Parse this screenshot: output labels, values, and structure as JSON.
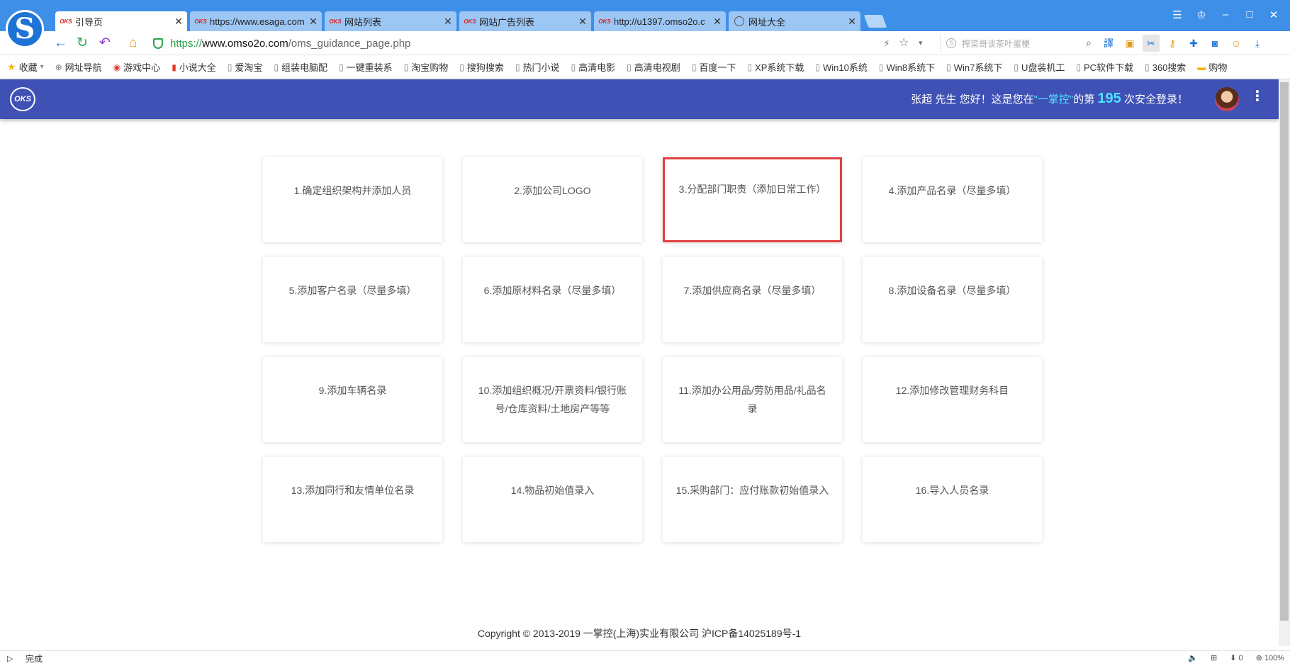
{
  "browser": {
    "tabs": [
      {
        "title": "引导页",
        "favicon": "OKS",
        "active": true
      },
      {
        "title": "https://www.esaga.com",
        "favicon": "OKS",
        "active": false
      },
      {
        "title": "网站列表",
        "favicon": "OKS",
        "active": false
      },
      {
        "title": "网站广告列表",
        "favicon": "OKS",
        "active": false
      },
      {
        "title": "http://u1397.omso2o.c",
        "favicon": "OKS",
        "active": false
      },
      {
        "title": "网址大全",
        "favicon": "globe-icon",
        "active": false
      }
    ],
    "close_glyph": "✕",
    "address": {
      "protocol": "https://",
      "host": "www.omso2o.com",
      "path": "/oms_guidance_page.php"
    },
    "search_placeholder": "搾菜哥谈茶叶蛋梗",
    "bookmarks": [
      {
        "label": "收藏",
        "icon": "star-icon"
      },
      {
        "label": "网址导航",
        "icon": "globe-icon"
      },
      {
        "label": "游戏中心",
        "icon": "game-icon"
      },
      {
        "label": "小说大全",
        "icon": "book-icon"
      },
      {
        "label": "爱淘宝",
        "icon": "page-icon"
      },
      {
        "label": "组装电脑配",
        "icon": "page-icon"
      },
      {
        "label": "一键重装系",
        "icon": "page-icon"
      },
      {
        "label": "淘宝购物",
        "icon": "page-icon"
      },
      {
        "label": "搜狗搜索",
        "icon": "page-icon"
      },
      {
        "label": "热门小说",
        "icon": "page-icon"
      },
      {
        "label": "高清电影",
        "icon": "page-icon"
      },
      {
        "label": "高清电视剧",
        "icon": "page-icon"
      },
      {
        "label": "百度一下",
        "icon": "page-icon"
      },
      {
        "label": "XP系统下载",
        "icon": "page-icon"
      },
      {
        "label": "Win10系统",
        "icon": "page-icon"
      },
      {
        "label": "Win8系统下",
        "icon": "page-icon"
      },
      {
        "label": "Win7系统下",
        "icon": "page-icon"
      },
      {
        "label": "U盘装机工",
        "icon": "page-icon"
      },
      {
        "label": "PC软件下载",
        "icon": "page-icon"
      },
      {
        "label": "360搜索",
        "icon": "page-icon"
      },
      {
        "label": "购物",
        "icon": "folder-icon"
      }
    ]
  },
  "header": {
    "logo_text": "OKS",
    "greeting_prefix": "张超 先生 您好！这是您在",
    "brand": "\"一掌控\"",
    "greeting_mid": "的第",
    "login_count": "195",
    "greeting_suffix": "次安全登录！"
  },
  "cards": [
    {
      "label": "1.确定组织架构并添加人员"
    },
    {
      "label": "2.添加公司LOGO"
    },
    {
      "label": "3.分配部门职责（添加日常工作）",
      "selected": true
    },
    {
      "label": "4.添加产品名录（尽量多填）"
    },
    {
      "label": "5.添加客户名录（尽量多填）"
    },
    {
      "label": "6.添加原材料名录（尽量多填）"
    },
    {
      "label": "7.添加供应商名录（尽量多填）"
    },
    {
      "label": "8.添加设备名录（尽量多填）"
    },
    {
      "label": "9.添加车辆名录"
    },
    {
      "label": "10.添加组织概况/开票资料/银行账号/仓库资料/土地房产等等"
    },
    {
      "label": "11.添加办公用品/劳防用品/礼品名录"
    },
    {
      "label": "12.添加修改管理财务科目"
    },
    {
      "label": "13.添加同行和友情单位名录"
    },
    {
      "label": "14.物品初始值录入"
    },
    {
      "label": "15.采购部门：应付账款初始值录入"
    },
    {
      "label": "16.导入人员名录"
    }
  ],
  "footer": {
    "text": "Copyright © 2013-2019 一掌控(上海)实业有限公司 沪ICP备14025189号-1"
  },
  "statusbar": {
    "status": "完成",
    "download_count": "0",
    "zoom": "100%"
  },
  "colors": {
    "header_bg": "#3f51b5",
    "highlight": "#4ee2ff",
    "selected_outline": "#e04040",
    "titlebar": "#3d8fe8"
  }
}
